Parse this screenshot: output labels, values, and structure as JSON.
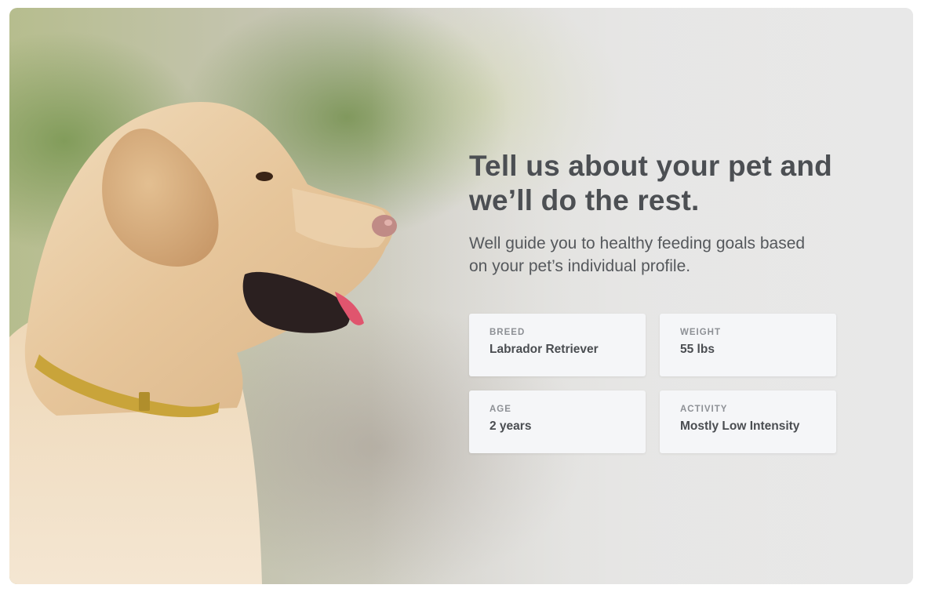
{
  "hero": {
    "headline_line1": "Tell us about your pet and",
    "headline_line2": "we’ll do the rest.",
    "subhead_line1": "Well guide you to healthy feeding goals based",
    "subhead_line2": "on your pet’s individual profile."
  },
  "profile_cards": [
    {
      "label": "BREED",
      "value": "Labrador Retriever"
    },
    {
      "label": "WEIGHT",
      "value": "55 lbs"
    },
    {
      "label": "AGE",
      "value": "2 years"
    },
    {
      "label": "ACTIVITY",
      "value": "Mostly Low Intensity"
    }
  ],
  "colors": {
    "headline": "#4c4f53",
    "card_bg": "#f5f6f8",
    "collar": "#c9a43a"
  }
}
